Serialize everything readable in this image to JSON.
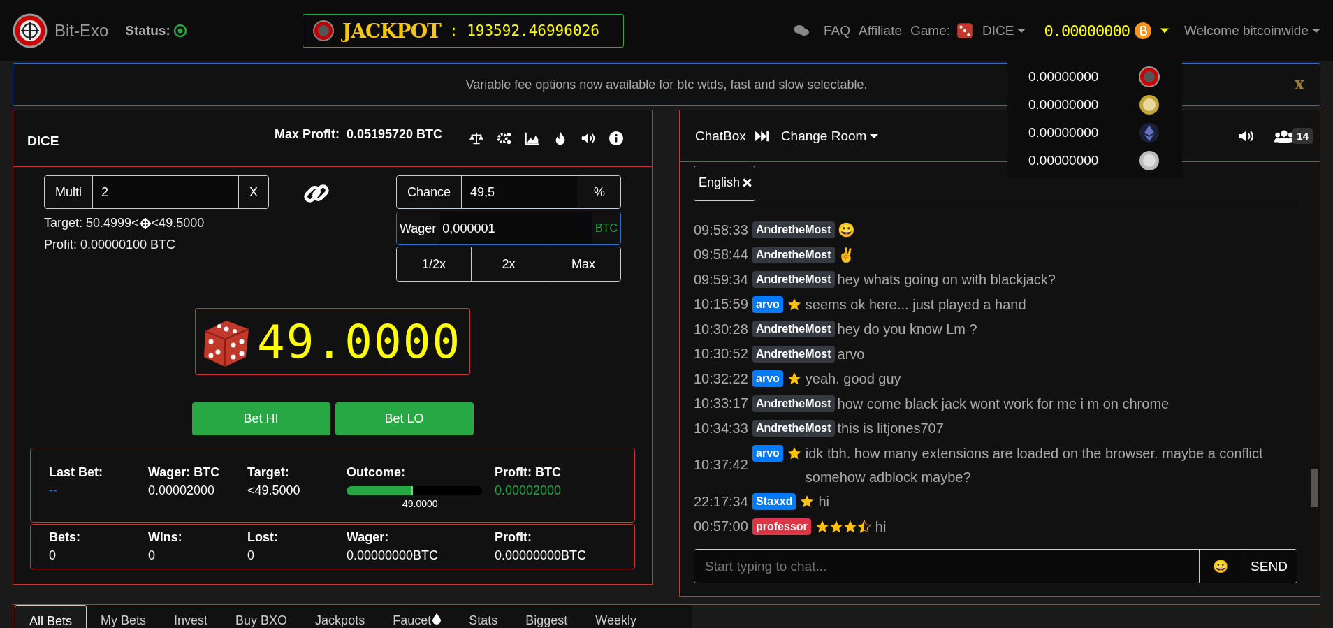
{
  "brand": {
    "name": "Bit-Exo",
    "status_label": "Status:"
  },
  "jackpot": {
    "label": "JACKPOT",
    "value": ": 193592.46996026"
  },
  "nav": {
    "faq": "FAQ",
    "affiliate": "Affiliate",
    "game_label": "Game:",
    "game": "DICE",
    "balance": "0.00000000",
    "welcome": "Welcome bitcoinwide"
  },
  "balance_menu": [
    {
      "amount": "0.00000000",
      "kind": "bxo"
    },
    {
      "amount": "0.00000000",
      "kind": "doge"
    },
    {
      "amount": "0.00000000",
      "kind": "eth"
    },
    {
      "amount": "0.00000000",
      "kind": "ltc"
    }
  ],
  "alert": {
    "text": "Variable fee options now available for btc wtds, fast and slow selectable.",
    "close": "x"
  },
  "dice": {
    "title": "DICE",
    "max_profit_label": "Max Profit:",
    "max_profit": "0.05195720 BTC",
    "multi": {
      "label": "Multi",
      "value": "2",
      "suffix": "X"
    },
    "chance": {
      "label": "Chance",
      "value": "49,5",
      "suffix": "%"
    },
    "wager": {
      "label": "Wager",
      "value": "0,000001",
      "suffix": "BTC"
    },
    "wager_buttons": [
      "1/2x",
      "2x",
      "Max"
    ],
    "target": {
      "prefix": "Target: 50.4999<",
      "suffix": "<49.5000"
    },
    "profit": "Profit: 0.00000100 BTC",
    "result": "49.0000",
    "bet_buttons": [
      "Bet HI",
      "Bet LO"
    ],
    "last_bet": [
      {
        "label": "Last Bet:",
        "value": "--",
        "kind": "link"
      },
      {
        "label": "Wager: BTC",
        "value": "0.00002000",
        "kind": "text"
      },
      {
        "label": "Target:",
        "value": "<49.5000",
        "kind": "text"
      },
      {
        "label": "Outcome:",
        "value": "49.0000",
        "kind": "bar",
        "level": 0.49
      },
      {
        "label": "Profit: BTC",
        "value": "0.00002000",
        "kind": "gain"
      }
    ],
    "totals": [
      {
        "label": "Bets:",
        "value": "0"
      },
      {
        "label": "Wins:",
        "value": "0"
      },
      {
        "label": "Lost:",
        "value": "0"
      },
      {
        "label": "Wager:",
        "value": "0.00000000BTC"
      },
      {
        "label": "Profit:",
        "value": "0.00000000BTC"
      }
    ]
  },
  "chat": {
    "title": "ChatBox",
    "room": "Change Room",
    "online": "14",
    "language": "English",
    "messages": [
      {
        "time": "09:58:33",
        "user": "AndretheMost",
        "color": "#343a40",
        "text": "😀"
      },
      {
        "time": "09:58:44",
        "user": "AndretheMost",
        "color": "#343a40",
        "text": "✌"
      },
      {
        "time": "09:59:34",
        "user": "AndretheMost",
        "color": "#343a40",
        "text": "hey whats going on with blackjack?"
      },
      {
        "time": "10:15:59",
        "user": "arvo",
        "color": "#007bff",
        "starred": true,
        "text": "seems ok here... just played a hand"
      },
      {
        "time": "10:30:28",
        "user": "AndretheMost",
        "color": "#343a40",
        "text": "hey do you know Lm ?"
      },
      {
        "time": "10:30:52",
        "user": "AndretheMost",
        "color": "#343a40",
        "text": "arvo"
      },
      {
        "time": "10:32:22",
        "user": "arvo",
        "color": "#007bff",
        "starred": true,
        "text": "yeah. good guy"
      },
      {
        "time": "10:33:17",
        "user": "AndretheMost",
        "color": "#343a40",
        "text": "how come black jack wont work for me i m on chrome"
      },
      {
        "time": "10:34:33",
        "user": "AndretheMost",
        "color": "#343a40",
        "text": "this is litjones707"
      },
      {
        "time": "10:37:42",
        "user": "arvo",
        "color": "#007bff",
        "starred": true,
        "text": "idk tbh. how many extensions are loaded on the browser. maybe a conflict somehow adblock maybe?"
      },
      {
        "time": "22:17:34",
        "user": "Staxxd",
        "color": "#007bff",
        "starred": true,
        "text": "hi"
      },
      {
        "time": "00:57:00",
        "user": "professor",
        "color": "#dc3545",
        "stars": 3.5,
        "text": "hi"
      }
    ],
    "input": {
      "placeholder": "Start typing to chat..."
    },
    "emoji": "😀",
    "send": "SEND"
  },
  "tabs": [
    {
      "label": "All Bets",
      "selected": true,
      "kind": "text"
    },
    {
      "label": "My Bets",
      "selected": false,
      "kind": "text"
    },
    {
      "label": "Invest",
      "selected": false,
      "kind": "text"
    },
    {
      "label": "Buy BXO",
      "selected": false,
      "kind": "text"
    },
    {
      "label": "Jackpots",
      "selected": false,
      "kind": "text"
    },
    {
      "label": "Faucet",
      "selected": false,
      "kind": "drop"
    },
    {
      "label": "Stats",
      "selected": false,
      "kind": "text"
    },
    {
      "label": "Biggest",
      "selected": false,
      "kind": "text"
    },
    {
      "label": "Weekly",
      "selected": false,
      "kind": "text"
    }
  ]
}
